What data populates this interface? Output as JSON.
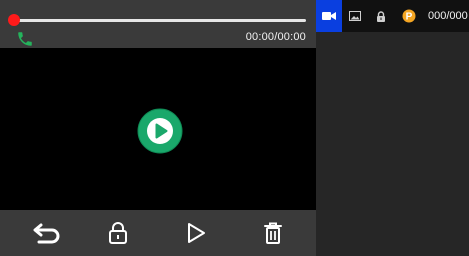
{
  "player": {
    "time_display": "00:00/00:00",
    "progress": 0
  },
  "toolbar": {
    "icons": [
      "back-icon",
      "lock-icon",
      "play-icon",
      "delete-icon"
    ]
  },
  "side_panel": {
    "tabs": [
      "video-icon",
      "image-icon",
      "lock-icon",
      "p-icon"
    ],
    "active_tab": "video-icon",
    "p_icon_label": "P",
    "counter": "000/000"
  },
  "colors": {
    "accent_blue": "#0a3fe0",
    "progress_knob": "#ff1a1a",
    "play_green": "#1aa86b",
    "phone_green": "#24b35c",
    "p_badge": "#f5a623"
  }
}
